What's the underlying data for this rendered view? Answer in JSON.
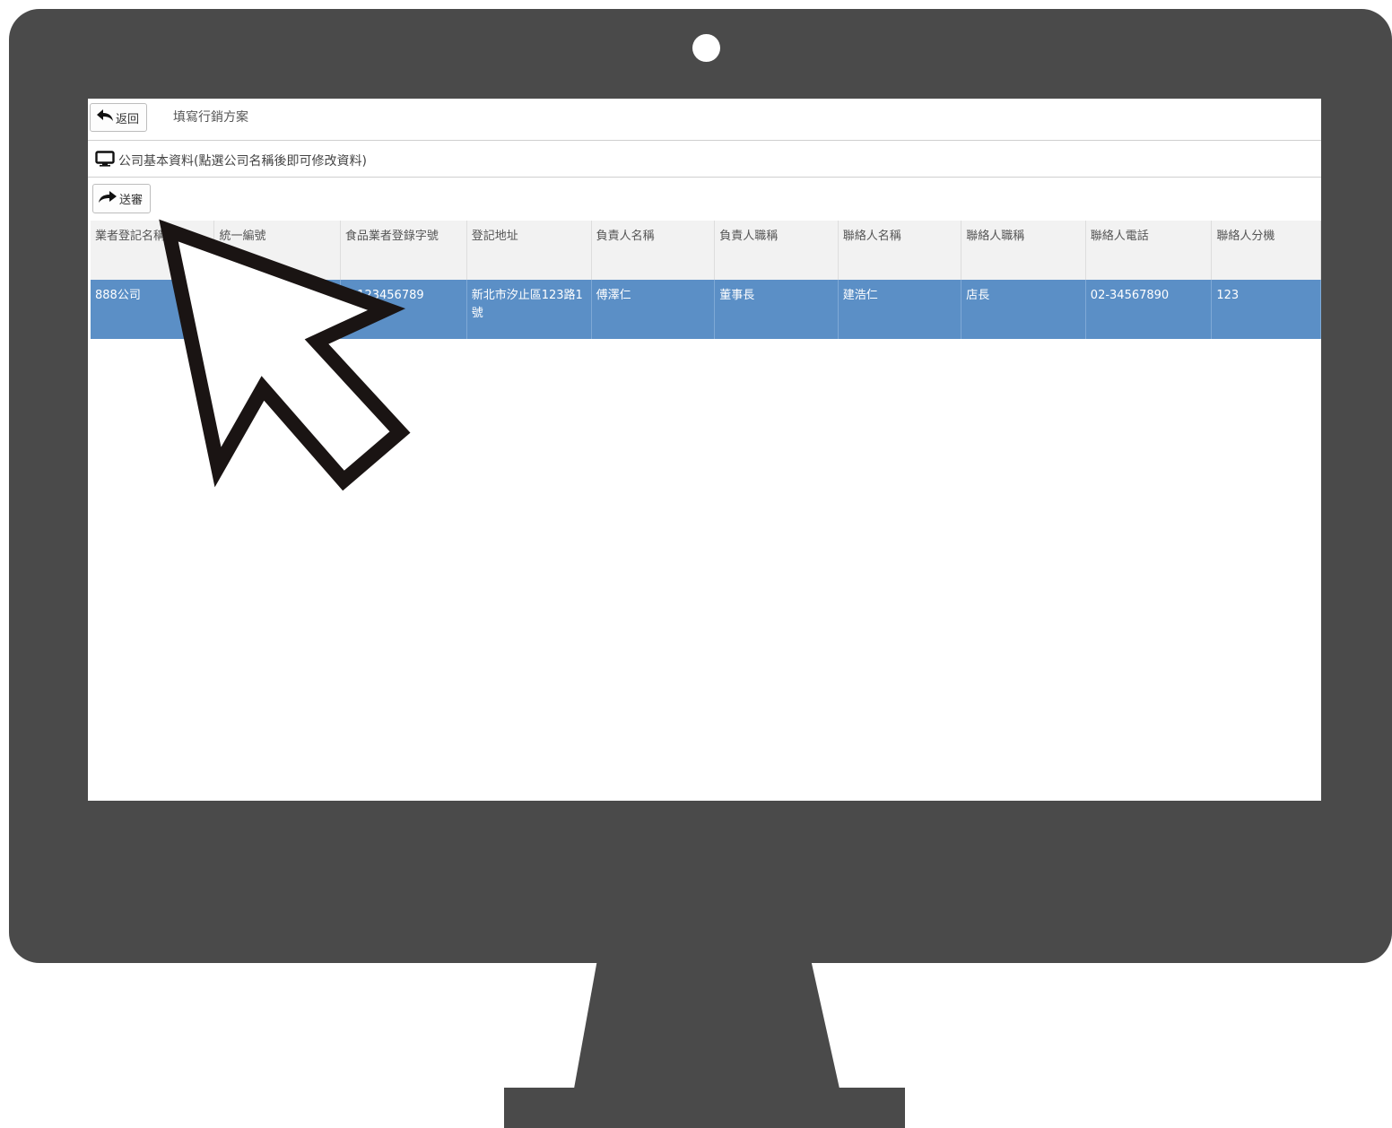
{
  "toolbar": {
    "back_label": "返回",
    "page_title": "填寫行銷方案"
  },
  "section": {
    "title": "公司基本資料(點選公司名稱後即可修改資料)"
  },
  "actions": {
    "export_label": "送審"
  },
  "table": {
    "columns": [
      "業者登記名稱",
      "統一編號",
      "食品業者登錄字號",
      "登記地址",
      "負責人名稱",
      "負責人職稱",
      "聯絡人名稱",
      "聯絡人職稱",
      "聯絡人電話",
      "聯絡人分機"
    ],
    "rows": [
      [
        "888公司",
        "",
        "A-123456789",
        "新北市汐止區123路1號",
        "傅澤仁",
        "董事長",
        "建浩仁",
        "店長",
        "02-34567890",
        "123"
      ]
    ]
  },
  "icons": {
    "back": "back-arrow-icon",
    "monitor": "monitor-icon",
    "export": "share-arrow-icon",
    "pointer": "mouse-pointer-icon"
  },
  "colors": {
    "frame": "#4a4a4a",
    "selected_row": "#5b8fc6",
    "header_bg": "#f2f2f2"
  }
}
